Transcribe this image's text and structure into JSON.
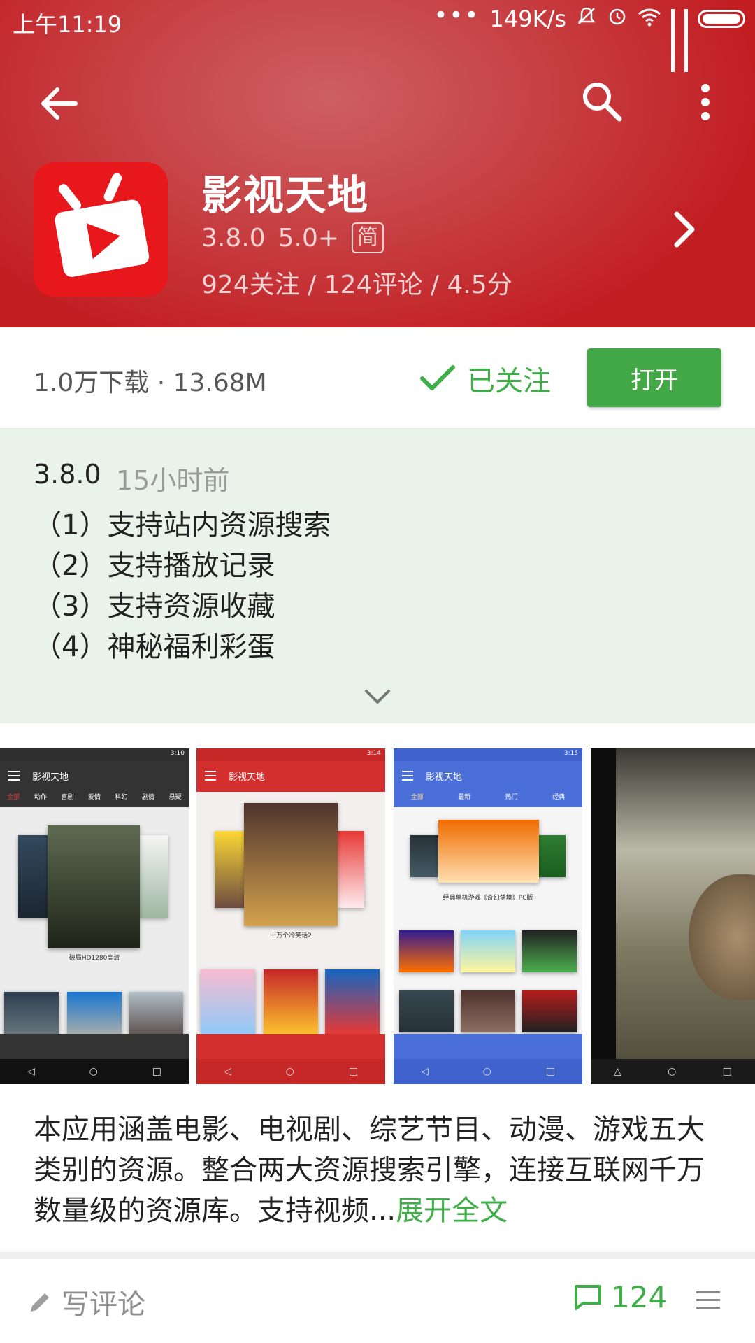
{
  "status_bar": {
    "time": "上午11:19",
    "network_speed": "149K/s",
    "more": "•••"
  },
  "toolbar": {
    "back_icon": "arrow-back-icon",
    "search_icon": "search-icon",
    "more_icon": "more-vert-icon"
  },
  "app": {
    "name": "影视天地",
    "version": "3.8.0",
    "android": "5.0+",
    "lang_badge": "简",
    "stats": "924关注 / 124评论 / 4.5分",
    "icon_color": "#e8171c"
  },
  "actions": {
    "downloads_size": "1.0万下载 · 13.68M",
    "followed_label": "已关注",
    "open_label": "打开"
  },
  "changelog": {
    "version": "3.8.0",
    "time": "15小时前",
    "items": [
      "（1）支持站内资源搜索",
      "（2）支持播放记录",
      "（3）支持资源收藏",
      "（4）神秘福利彩蛋"
    ]
  },
  "screenshots": [
    {
      "app_title": "影视天地",
      "time": "3:10",
      "tabs": [
        "全部",
        "动作",
        "喜剧",
        "爱情",
        "科幻",
        "剧情",
        "悬疑"
      ],
      "caption": "破局HD1280高清",
      "theme": "#333333"
    },
    {
      "app_title": "影视天地",
      "time": "3:14",
      "tabs": [],
      "caption": "十万个冷笑话2",
      "theme": "#d32f2f"
    },
    {
      "app_title": "影视天地",
      "time": "3:15",
      "tabs": [
        "全部",
        "最新",
        "热门",
        "经典"
      ],
      "caption": "经典单机游戏《奇幻梦境》PC版",
      "theme": "#4a6fd8"
    }
  ],
  "description": {
    "text": "本应用涵盖电影、电视剧、综艺节目、动漫、游戏五大类别的资源。整合两大资源搜索引擎，连接互联网千万数量级的资源库。支持视频...",
    "more": "展开全文"
  },
  "footer": {
    "write_review": "写评论",
    "comment_count": "124"
  },
  "colors": {
    "header_red": "#c21e22",
    "accent_green": "#3fae49",
    "changelog_bg": "#e9f3ea"
  }
}
